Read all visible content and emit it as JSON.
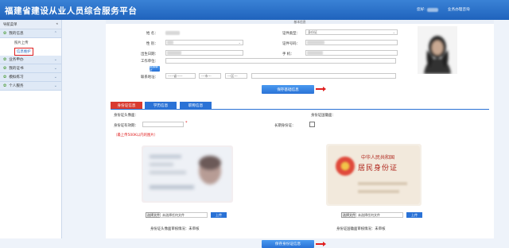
{
  "header": {
    "title": "福建省建设从业人员综合服务平台",
    "user_prefix": "您好:",
    "link": "业务办理咨询",
    "colors": {
      "bar": "#1f63bd",
      "accent": "#2a72d6",
      "alert": "#e02020"
    }
  },
  "sidebar": {
    "title": "导航菜单",
    "collapse": "«",
    "groups": [
      {
        "label": "我的信息",
        "subs": [
          "照片上传",
          "信息维护"
        ],
        "selected": 1
      },
      {
        "label": "业务申办"
      },
      {
        "label": "我的证书"
      },
      {
        "label": "模拟练习"
      },
      {
        "label": "个人服务"
      }
    ]
  },
  "basic": {
    "section_title": "基本信息",
    "labels": {
      "name": "姓 名：",
      "gender": "性 别：",
      "birth": "出生日期：",
      "workplace": "工作单位：",
      "address": "联系地址：",
      "id_type": "证件类型：",
      "id_no": "证件号码：",
      "mobile": "手 机："
    },
    "id_type_value": "身份证",
    "add_unit_btn": "选择单位",
    "addr": {
      "province": "-----省-----",
      "city": "---市---",
      "district": "---区---"
    },
    "save_btn": "保存基础信息"
  },
  "tabs": [
    "身份证信息",
    "学历信息",
    "职称信息"
  ],
  "idcard": {
    "front_label": "身份证头像面：",
    "back_label": "身份证国徽面：",
    "expiry_label": "身份证有效期：",
    "long_term_label": "长期身份证：",
    "notice": "（最上传500K以内的图片）",
    "back_card_text": {
      "line1": "中华人民共和国",
      "line2": "居民身份证"
    },
    "choose_btn": "选择文件",
    "no_file": "未选择任何文件",
    "upload_btn": "上传",
    "front_status": "身份证头像面审核情况：未审核",
    "back_status": "身份证国徽面审核情况：未审核",
    "save_btn": "保存身份证信息"
  }
}
